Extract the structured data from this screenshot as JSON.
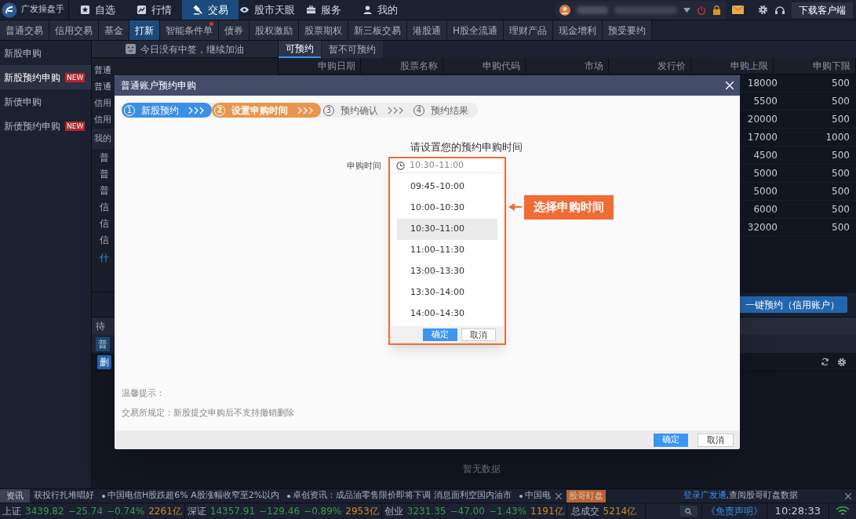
{
  "app": {
    "name": "广发操盘手",
    "download": "下载客户端"
  },
  "nav": [
    {
      "label": "自选",
      "kind": "star",
      "selected": false
    },
    {
      "label": "行情",
      "kind": "chart",
      "selected": false
    },
    {
      "label": "交易",
      "kind": "hammer",
      "selected": true
    },
    {
      "label": "股市天眼",
      "kind": "eye",
      "selected": false
    },
    {
      "label": "服务",
      "kind": "briefcase",
      "selected": false
    },
    {
      "label": "我的",
      "kind": "user",
      "selected": false
    }
  ],
  "subtabs": [
    {
      "label": "普通交易",
      "selected": false,
      "dot": false
    },
    {
      "label": "信用交易",
      "selected": false,
      "dot": false
    },
    {
      "label": "基金",
      "selected": false,
      "dot": false
    },
    {
      "label": "打新",
      "selected": true,
      "dot": false
    },
    {
      "label": "智能条件单",
      "selected": false,
      "dot": true
    },
    {
      "label": "债券",
      "selected": false,
      "dot": false
    },
    {
      "label": "股权激励",
      "selected": false,
      "dot": false
    },
    {
      "label": "股票期权",
      "selected": false,
      "dot": false
    },
    {
      "label": "新三板交易",
      "selected": false,
      "dot": false
    },
    {
      "label": "港股通",
      "selected": false,
      "dot": false
    },
    {
      "label": "H股全流通",
      "selected": false,
      "dot": false
    },
    {
      "label": "理财产品",
      "selected": false,
      "dot": false
    },
    {
      "label": "现金增利",
      "selected": false,
      "dot": false
    },
    {
      "label": "预受要约",
      "selected": false,
      "dot": false
    }
  ],
  "sidebar": [
    {
      "label": "新股申购",
      "selected": false
    },
    {
      "label": "新股预约申购",
      "badge": "NEW",
      "selected": true
    },
    {
      "label": "新债申购",
      "selected": false
    },
    {
      "label": "新债预约申购",
      "badge": "NEW",
      "selected": false
    }
  ],
  "banner": "今日没有中签，继续加油",
  "list_labels": [
    {
      "label": "普通",
      "kind": "item"
    },
    {
      "label": "普通",
      "kind": "item"
    },
    {
      "label": "信用",
      "kind": "item"
    },
    {
      "label": "信用",
      "kind": "item"
    },
    {
      "label": "我的",
      "kind": "header"
    },
    {
      "label": "普",
      "kind": "sub"
    },
    {
      "label": "普",
      "kind": "sub"
    },
    {
      "label": "普",
      "kind": "sub"
    },
    {
      "label": "信",
      "kind": "sub"
    },
    {
      "label": "信",
      "kind": "sub"
    },
    {
      "label": "信",
      "kind": "sub"
    },
    {
      "label": "什",
      "kind": "link"
    }
  ],
  "table_tabs": [
    {
      "label": "可预约",
      "selected": true
    },
    {
      "label": "暂不可预约",
      "selected": false
    }
  ],
  "table": {
    "columns": [
      "申购日期",
      "股票名称",
      "申购代码",
      "市场",
      "发行价",
      "申购上限",
      "申购下限"
    ],
    "rows": [
      {
        "upper": "18000",
        "lower": "500"
      },
      {
        "upper": "5500",
        "lower": "500"
      },
      {
        "upper": "20000",
        "lower": "500"
      },
      {
        "upper": "17000",
        "lower": "1000"
      },
      {
        "upper": "4500",
        "lower": "500"
      },
      {
        "upper": "5000",
        "lower": "500"
      },
      {
        "upper": "5000",
        "lower": "500"
      },
      {
        "upper": "6000",
        "lower": "500"
      },
      {
        "upper": "32000",
        "lower": "500"
      }
    ]
  },
  "credit_button": "一键预约（信用账户）",
  "lower": {
    "tab": "待",
    "subtab": "普",
    "button": "删",
    "empty": "暂无数据"
  },
  "dialog": {
    "title": "普通账户预约申购",
    "steps": [
      {
        "number": "1",
        "label": "新股预约",
        "done": true,
        "selected": false
      },
      {
        "number": "2",
        "label": "设置申购时间",
        "done": false,
        "selected": true
      },
      {
        "number": "3",
        "label": "预约确认",
        "done": false,
        "selected": false
      },
      {
        "number": "4",
        "label": "预约结果",
        "done": false,
        "selected": false
      }
    ],
    "heading": "请设置您的预约申购时间",
    "field_label": "申购时间",
    "field_value": "10:30–11:00",
    "options": [
      {
        "label": "09:45–10:00",
        "selected": false
      },
      {
        "label": "10:00–10:30",
        "selected": false
      },
      {
        "label": "10:30–11:00",
        "selected": true
      },
      {
        "label": "11:00–11:30",
        "selected": false
      },
      {
        "label": "13:00–13:30",
        "selected": false
      },
      {
        "label": "13:30–14:00",
        "selected": false
      },
      {
        "label": "14:00–14:30",
        "selected": false
      }
    ],
    "dropdown_ok": "确定",
    "dropdown_cancel": "取消",
    "callout": "选择申购时间",
    "tips_title": "温馨提示：",
    "tips": "交易所规定：新股提交申购后不支持撤销删除",
    "ok": "确定",
    "cancel": "取消"
  },
  "ticker": {
    "label": "资讯",
    "items": [
      {
        "text": "获投行扎堆唱好",
        "bullet": false
      },
      {
        "text": "中国电信H股跌超6% A股涨幅收窄至2%以内",
        "bullet": true
      },
      {
        "text": "卓创资讯：成品油零售限价即将下调 消息面利空国内油市",
        "bullet": true
      },
      {
        "text": "中国电",
        "bullet": true
      }
    ],
    "badge": "股哥盯盘",
    "link": "登录广发通",
    "link_text": ",查阅股哥盯盘数据"
  },
  "indices": [
    {
      "name": "上证",
      "value": "3439.82",
      "change": "−25.74",
      "pct": "−0.74%",
      "amount": "2261亿"
    },
    {
      "name": "深证",
      "value": "14357.91",
      "change": "−129.46",
      "pct": "−0.89%",
      "amount": "2953亿"
    },
    {
      "name": "创业",
      "value": "3231.35",
      "change": "−47.00",
      "pct": "−1.43%",
      "amount": "1191亿"
    }
  ],
  "total": {
    "label": "总成交",
    "amount": "5214亿"
  },
  "disclaimer": "《免责声明》",
  "time": "10:28:33"
}
